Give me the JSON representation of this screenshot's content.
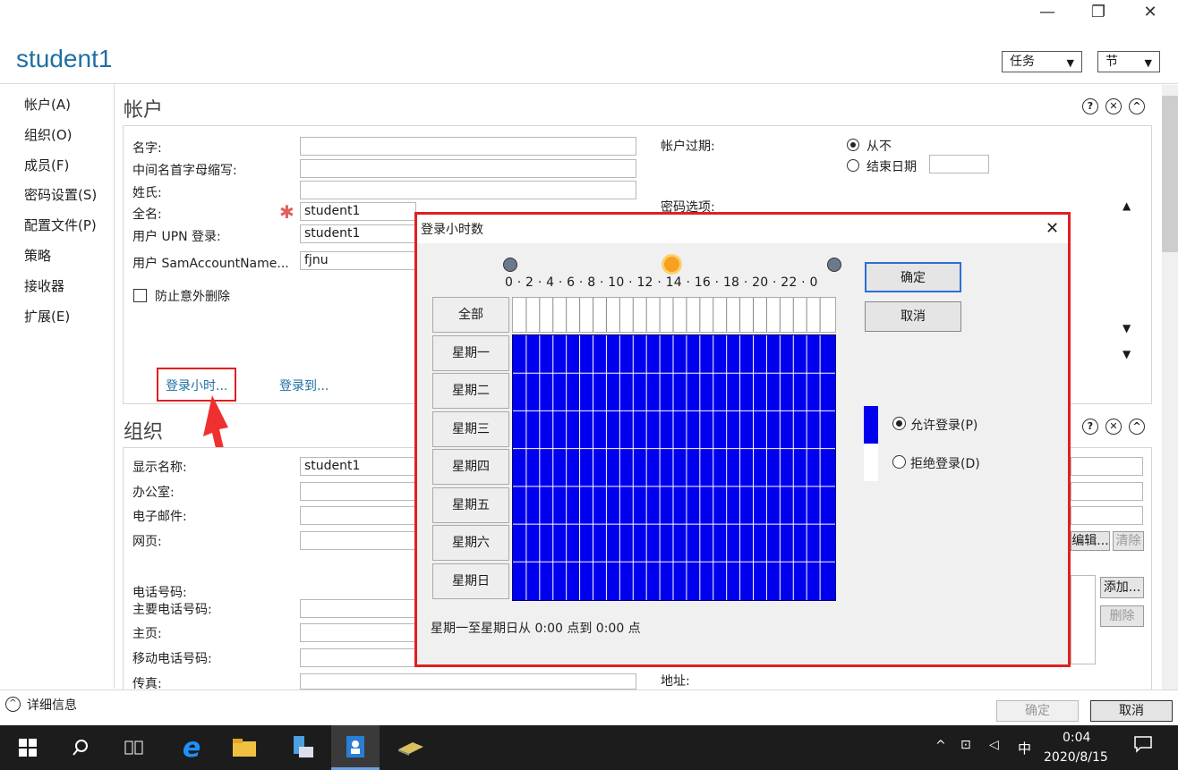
{
  "window": {
    "minimize": "—",
    "restore": "❐",
    "close": "✕"
  },
  "title": "student1",
  "header": {
    "tasks_label": "任务",
    "section_label": "节"
  },
  "nav": [
    "帐户(A)",
    "组织(O)",
    "成员(F)",
    "密码设置(S)",
    "配置文件(P)",
    "策略",
    "接收器",
    "扩展(E)"
  ],
  "account": {
    "heading": "帐户",
    "fields": [
      {
        "label": "名字:",
        "value": ""
      },
      {
        "label": "中间名首字母缩写:",
        "value": ""
      },
      {
        "label": "姓氏:",
        "value": ""
      },
      {
        "label": "全名:",
        "value": "student1"
      },
      {
        "label": "用户 UPN 登录:",
        "value": "student1"
      },
      {
        "label": "用户 SamAccountName...",
        "value": "fjnu"
      }
    ],
    "protect_label": "防止意外删除",
    "expiry_label": "帐户过期:",
    "expiry_never": "从不",
    "expiry_end": "结束日期",
    "pwd_options": "密码选项:",
    "logon_hours_link": "登录小时...",
    "logon_to_link": "登录到..."
  },
  "org": {
    "heading": "组织",
    "fields": [
      {
        "label": "显示名称:",
        "value": "student1"
      },
      {
        "label": "办公室:",
        "value": ""
      },
      {
        "label": "电子邮件:",
        "value": ""
      },
      {
        "label": "网页:",
        "value": ""
      }
    ],
    "phone_heading": "电话号码:",
    "phones": [
      "主要电话号码:",
      "主页:",
      "移动电话号码:",
      "传真:"
    ],
    "edit_btn": "编辑...",
    "clear_btn": "清除",
    "add_btn": "添加...",
    "delete_btn": "删除",
    "address_label": "地址:"
  },
  "footer": {
    "details": "详细信息",
    "ok": "确定",
    "cancel": "取消"
  },
  "dialog": {
    "title": "登录小时数",
    "hour_labels": "0 · 2 · 4 · 6 · 8 · 10 · 12 · 14 · 16 · 18 · 20 · 22 · 0",
    "all_label": "全部",
    "days": [
      "星期一",
      "星期二",
      "星期三",
      "星期四",
      "星期五",
      "星期六",
      "星期日"
    ],
    "ok": "确定",
    "cancel": "取消",
    "allow": "允许登录(P)",
    "deny": "拒绝登录(D)",
    "status": "星期一至星期日从 0:00 点到 0:00 点",
    "allowed_color": "#0000ee"
  },
  "taskbar": {
    "ime": "中",
    "time": "0:04",
    "date": "2020/8/15"
  }
}
